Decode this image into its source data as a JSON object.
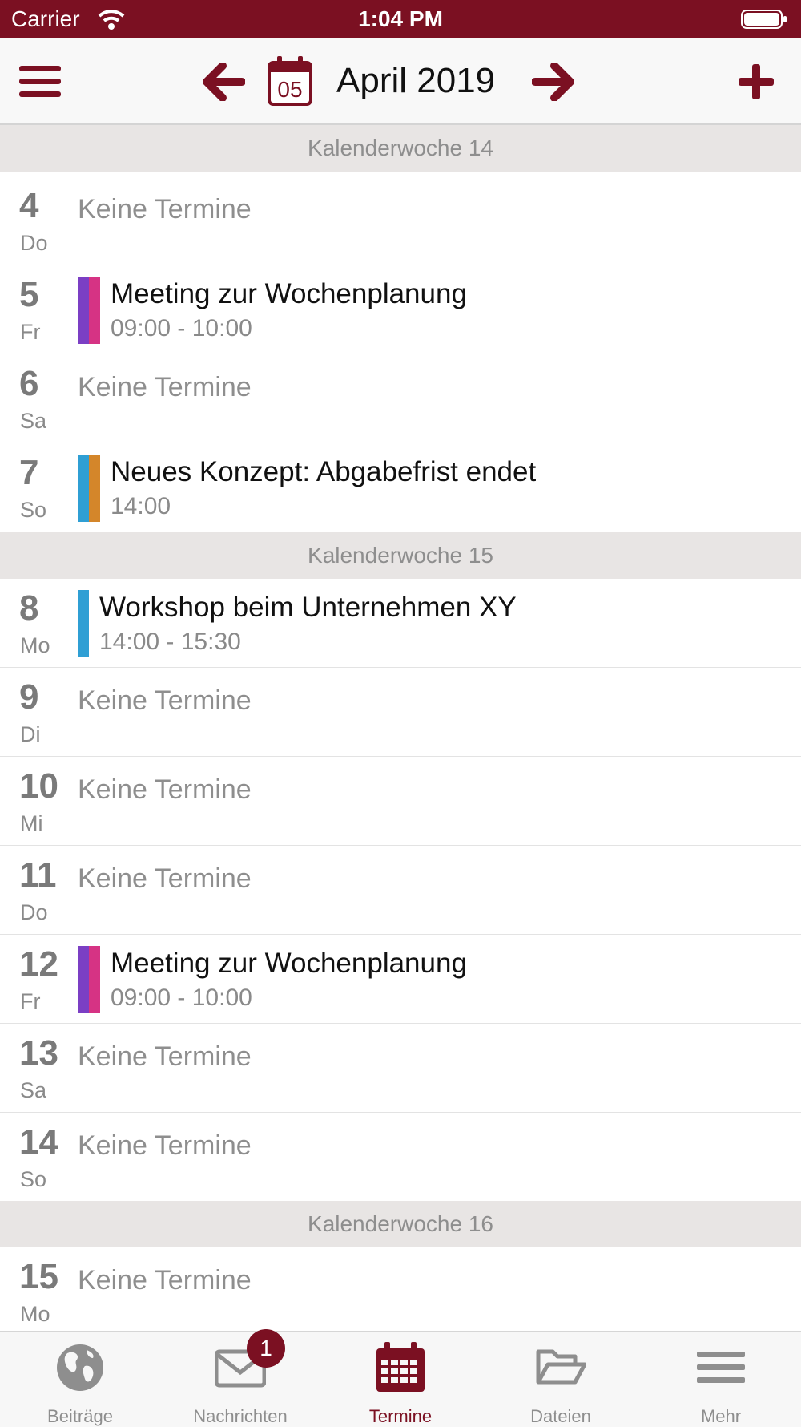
{
  "status_bar": {
    "carrier": "Carrier",
    "time": "1:04 PM"
  },
  "nav": {
    "title": "April 2019",
    "calendar_day": "05"
  },
  "colors": {
    "brand": "#7b1022",
    "purple": "#7b3fc4",
    "pink": "#d63384",
    "blue": "#2f9fd4",
    "orange": "#d4862a"
  },
  "weeks": [
    {
      "label": "Kalenderwoche 14"
    },
    {
      "label": "Kalenderwoche 15"
    },
    {
      "label": "Kalenderwoche 16"
    }
  ],
  "days": [
    {
      "num": "4",
      "weekday": "Do",
      "empty": "Keine Termine"
    },
    {
      "num": "5",
      "weekday": "Fr",
      "title": "Meeting zur Wochenplanung",
      "time": "09:00 - 10:00"
    },
    {
      "num": "6",
      "weekday": "Sa",
      "empty": "Keine Termine"
    },
    {
      "num": "7",
      "weekday": "So",
      "title": "Neues Konzept: Abgabefrist endet",
      "time": "14:00"
    },
    {
      "num": "8",
      "weekday": "Mo",
      "title": "Workshop beim Unternehmen XY",
      "time": "14:00 - 15:30"
    },
    {
      "num": "9",
      "weekday": "Di",
      "empty": "Keine Termine"
    },
    {
      "num": "10",
      "weekday": "Mi",
      "empty": "Keine Termine"
    },
    {
      "num": "11",
      "weekday": "Do",
      "empty": "Keine Termine"
    },
    {
      "num": "12",
      "weekday": "Fr",
      "title": "Meeting zur Wochenplanung",
      "time": "09:00 - 10:00"
    },
    {
      "num": "13",
      "weekday": "Sa",
      "empty": "Keine Termine"
    },
    {
      "num": "14",
      "weekday": "So",
      "empty": "Keine Termine"
    },
    {
      "num": "15",
      "weekday": "Mo",
      "empty": "Keine Termine"
    }
  ],
  "tabs": [
    {
      "label": "Beiträge",
      "icon": "globe-icon"
    },
    {
      "label": "Nachrichten",
      "icon": "envelope-icon",
      "badge": "1"
    },
    {
      "label": "Termine",
      "icon": "calendar-icon",
      "active": true
    },
    {
      "label": "Dateien",
      "icon": "folder-icon"
    },
    {
      "label": "Mehr",
      "icon": "menu-icon"
    }
  ]
}
